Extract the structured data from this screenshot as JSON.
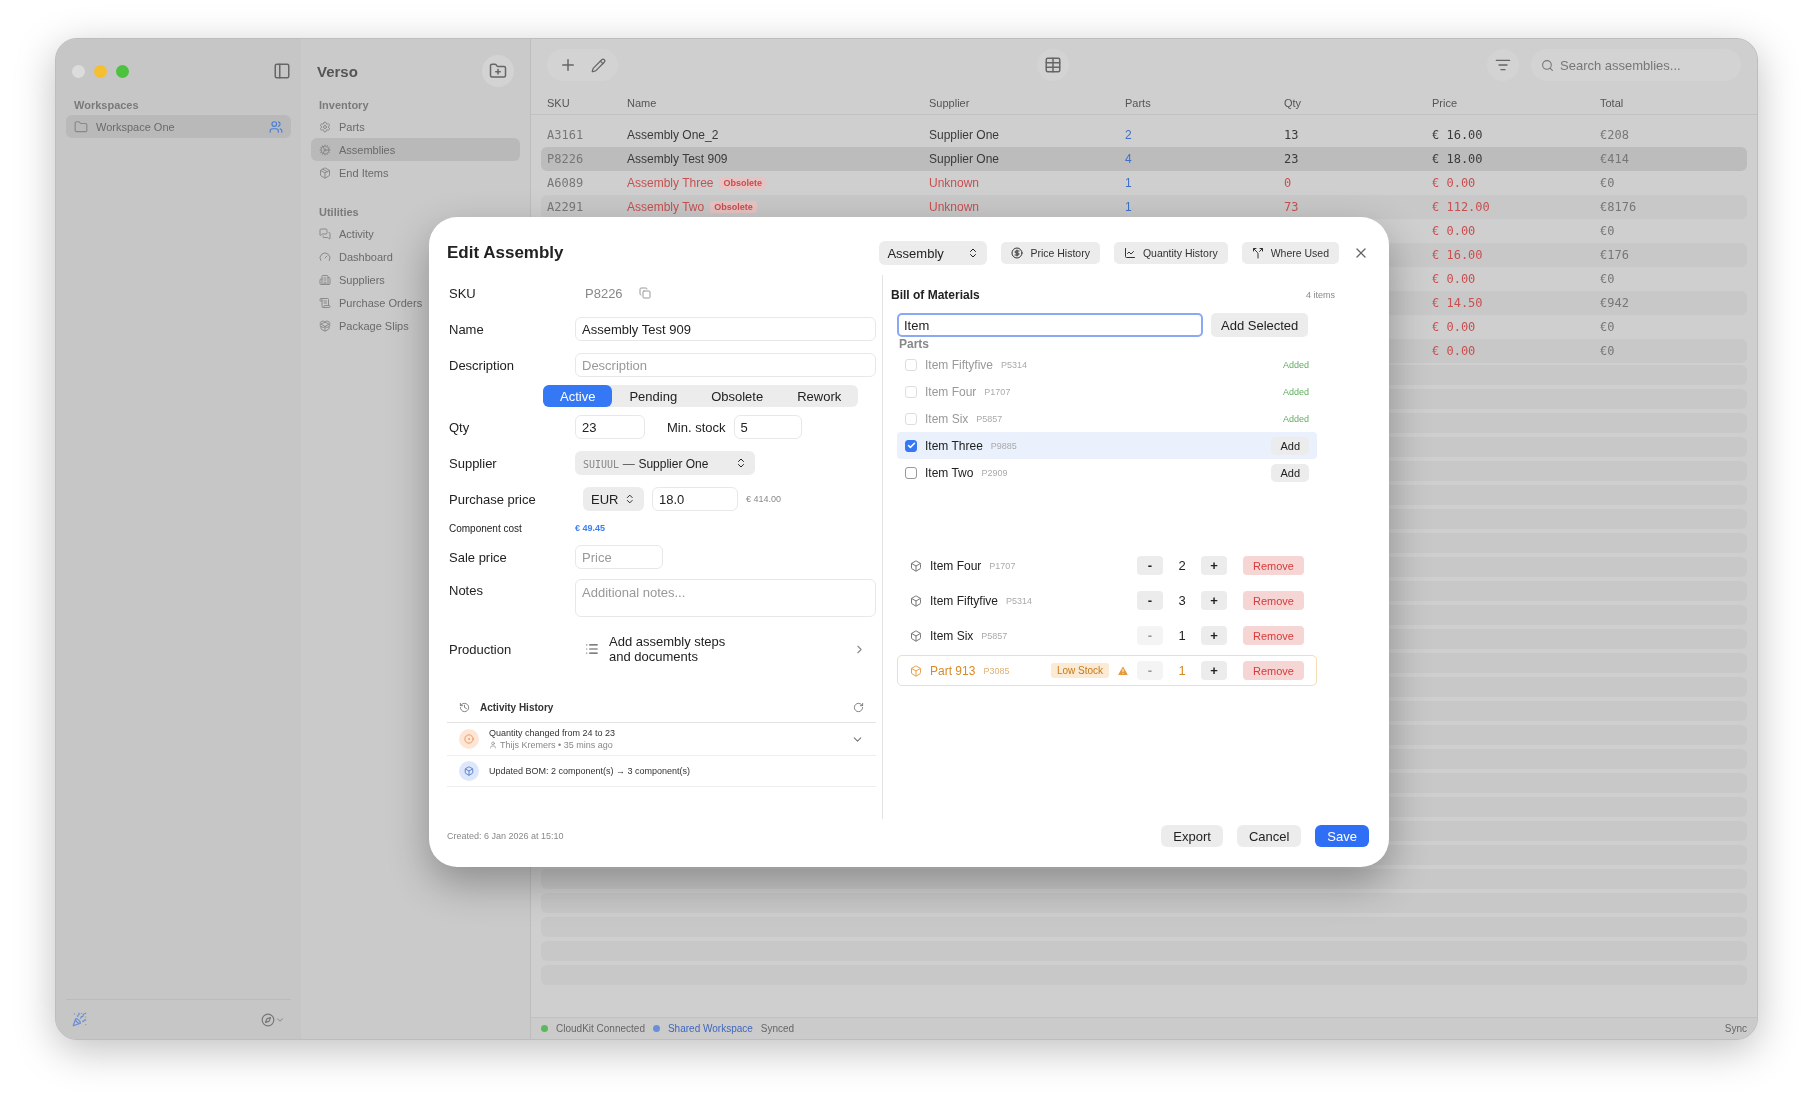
{
  "sidebar": {
    "heading": "Workspaces",
    "items": [
      {
        "label": "Workspace One",
        "selected": true
      }
    ]
  },
  "navigation": {
    "title": "Verso",
    "sections": [
      {
        "title": "Inventory",
        "items": [
          {
            "label": "Parts",
            "selected": false
          },
          {
            "label": "Assemblies",
            "selected": true
          },
          {
            "label": "End Items",
            "selected": false
          }
        ]
      },
      {
        "title": "Utilities",
        "items": [
          {
            "label": "Activity",
            "selected": false
          },
          {
            "label": "Dashboard",
            "selected": false
          },
          {
            "label": "Suppliers",
            "selected": false
          },
          {
            "label": "Purchase Orders",
            "selected": false
          },
          {
            "label": "Package Slips",
            "selected": false
          }
        ]
      }
    ]
  },
  "toolbar": {
    "search": {
      "placeholder": "Search assemblies..."
    }
  },
  "table": {
    "columns": [
      "SKU",
      "Name",
      "Supplier",
      "Parts",
      "Qty",
      "Price",
      "Total"
    ],
    "rows": [
      {
        "sku": "A3161",
        "name": "Assembly One_2",
        "supplier": "Supplier One",
        "parts": "2",
        "qty": "13",
        "price": "€ 16.00",
        "total": "€208",
        "selected": false,
        "flagged": false
      },
      {
        "sku": "P8226",
        "name": "Assembly Test 909",
        "supplier": "Supplier One",
        "parts": "4",
        "qty": "23",
        "price": "€ 18.00",
        "total": "€414",
        "selected": true,
        "flagged": false
      },
      {
        "sku": "A6089",
        "name": "Assembly Three",
        "badge": "Obsolete",
        "supplier": "Unknown",
        "parts": "1",
        "qty": "0",
        "price": "€ 0.00",
        "total": "€0",
        "selected": false,
        "flagged": true
      },
      {
        "sku": "A2291",
        "name": "Assembly Two",
        "badge": "Obsolete",
        "supplier": "Unknown",
        "parts": "1",
        "qty": "73",
        "price": "€ 112.00",
        "total": "€8176",
        "selected": false,
        "flagged": true
      },
      {
        "price": "€ 0.00",
        "total": "€0",
        "selected": false,
        "flagged": true
      },
      {
        "price": "€ 16.00",
        "total": "€176",
        "selected": false,
        "flagged": true
      },
      {
        "price": "€ 0.00",
        "total": "€0",
        "selected": false,
        "flagged": true
      },
      {
        "price": "€ 14.50",
        "total": "€942",
        "selected": false,
        "flagged": true
      },
      {
        "price": "€ 0.00",
        "total": "€0",
        "selected": false,
        "flagged": true
      },
      {
        "price": "€ 0.00",
        "total": "€0",
        "selected": false,
        "flagged": true
      }
    ]
  },
  "dialog": {
    "title": "Edit Assembly",
    "type_select": "Assembly",
    "header_buttons": [
      {
        "label": "Price History",
        "kind": "price"
      },
      {
        "label": "Quantity History",
        "kind": "quantity"
      },
      {
        "label": "Where Used",
        "kind": "used"
      }
    ],
    "form": {
      "sku_label": "SKU",
      "sku": "P8226",
      "name_label": "Name",
      "name": "Assembly Test 909",
      "description_label": "Description",
      "description_placeholder": "Description",
      "status_tabs": [
        {
          "label": "Active",
          "selected": true
        },
        {
          "label": "Pending",
          "selected": false
        },
        {
          "label": "Obsolete",
          "selected": false
        },
        {
          "label": "Rework",
          "selected": false
        }
      ],
      "qty_label": "Qty",
      "qty": "23",
      "min_stock_label": "Min. stock",
      "min_stock": "5",
      "supplier_label": "Supplier",
      "supplier_code": "SUIUUL",
      "supplier_separator": "—",
      "supplier": "Supplier One",
      "purchase_label": "Purchase price",
      "currency": "EUR",
      "purchase_price": "18.0",
      "purchase_total": "€ 414.00",
      "component_cost_label": "Component cost",
      "component_cost": "€ 49.45",
      "sale_label": "Sale price",
      "sale_placeholder": "Price",
      "notes_label": "Notes",
      "notes_placeholder": "Additional notes...",
      "production_label": "Production",
      "production_link": "Add assembly steps and documents"
    },
    "activity": {
      "title": "Activity History",
      "entries": [
        {
          "kind": "quantity",
          "text": "Quantity changed from 24 to 23",
          "user": "Thijs Kremers",
          "separator": "•",
          "time": "35 mins ago"
        },
        {
          "kind": "bom",
          "text": "Updated BOM: 2 component(s) → 3 component(s)"
        }
      ]
    },
    "created": "Created: 6 Jan 2026 at 15:10",
    "bom": {
      "title": "Bill of Materials",
      "count": "4 items",
      "search": "Item",
      "add_selected": "Add Selected",
      "section": "Parts",
      "results": [
        {
          "name": "Item Fiftyfive",
          "code": "P5314",
          "added": true,
          "action": "Added",
          "checked": false,
          "selected": false
        },
        {
          "name": "Item Four",
          "code": "P1707",
          "added": true,
          "action": "Added",
          "checked": false,
          "selected": false
        },
        {
          "name": "Item Six",
          "code": "P5857",
          "added": true,
          "action": "Added",
          "checked": false,
          "selected": false
        },
        {
          "name": "Item Three",
          "code": "P9885",
          "added": false,
          "action": "Add",
          "checked": true,
          "selected": true
        },
        {
          "name": "Item Two",
          "code": "P2909",
          "added": false,
          "action": "Add",
          "checked": false,
          "selected": false
        }
      ],
      "components": [
        {
          "name": "Item Four",
          "code": "P1707",
          "minus": "-",
          "qty": "2",
          "plus": "+",
          "remove": "Remove",
          "minus_disabled": false,
          "alert": false
        },
        {
          "name": "Item Fiftyfive",
          "code": "P5314",
          "minus": "-",
          "qty": "3",
          "plus": "+",
          "remove": "Remove",
          "minus_disabled": false,
          "alert": false
        },
        {
          "name": "Item Six",
          "code": "P5857",
          "minus": "-",
          "qty": "1",
          "plus": "+",
          "remove": "Remove",
          "minus_disabled": true,
          "alert": false
        },
        {
          "name": "Part 913",
          "code": "P3085",
          "badge": "Low Stock",
          "minus": "-",
          "qty": "1",
          "plus": "+",
          "remove": "Remove",
          "minus_disabled": true,
          "alert": true
        }
      ]
    },
    "footer_buttons": [
      {
        "label": "Export",
        "kind": "secondary"
      },
      {
        "label": "Cancel",
        "kind": "secondary"
      },
      {
        "label": "Save",
        "kind": "primary"
      }
    ]
  },
  "status_bar": {
    "items": [
      {
        "label": "CloudKit Connected",
        "color": "#5cb85c",
        "link": false
      },
      {
        "label": "Shared Workspace",
        "color": "#6a8fd8",
        "link": true
      }
    ],
    "state": "Synced",
    "right": "Sync"
  }
}
